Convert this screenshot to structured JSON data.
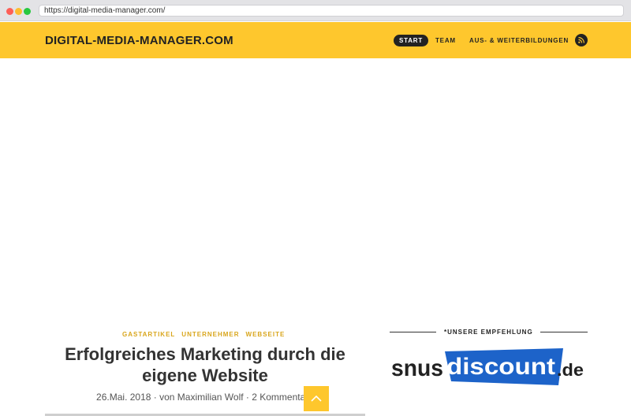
{
  "browser": {
    "url": "https://digital-media-manager.com/"
  },
  "header": {
    "site_title": "DIGITAL-MEDIA-MANAGER.COM",
    "nav": [
      {
        "label": "START",
        "active": true
      },
      {
        "label": "TEAM",
        "active": false
      },
      {
        "label": "AUS- & WEITERBILDUNGEN",
        "active": false
      }
    ],
    "rss_icon": "rss-icon",
    "accent_color": "#fec72d"
  },
  "post": {
    "categories": [
      "GASTARTIKEL",
      "UNTERNEHMER",
      "WEBSEITE"
    ],
    "title": "Erfolgreiches Marketing durch die eigene Website",
    "meta": "26.Mai. 2018 · von Maximilian Wolf · 2 Kommentare"
  },
  "sidebar": {
    "widget_title": "*UNSERE EMPFEHLUNG",
    "logo_text_a": "snus",
    "logo_text_b": "discount",
    "logo_text_c": ".de",
    "logo_color": "#1d63c9"
  },
  "scroll_top_icon": "chevron-up-icon"
}
